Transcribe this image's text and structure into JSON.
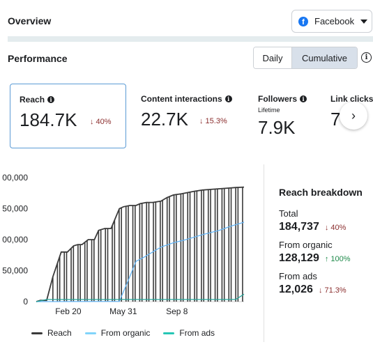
{
  "header": {
    "title": "Overview",
    "platform": {
      "label": "Facebook",
      "icon": "facebook-icon"
    }
  },
  "performance": {
    "title": "Performance",
    "toggles": [
      {
        "label": "Daily",
        "active": false
      },
      {
        "label": "Cumulative",
        "active": true
      }
    ]
  },
  "metrics": [
    {
      "label": "Reach",
      "value": "184.7K",
      "change": "↓ 40%",
      "selected": true
    },
    {
      "label": "Content interactions",
      "value": "22.7K",
      "change": "↓ 15.3%",
      "selected": false
    },
    {
      "label": "Followers",
      "sub": "Lifetime",
      "value": "7.9K",
      "selected": false
    },
    {
      "label": "Link clicks",
      "value": "7",
      "selected": false
    }
  ],
  "breakdown": {
    "title": "Reach breakdown",
    "rows": [
      {
        "label": "Total",
        "value": "184,737",
        "change": "↓ 40%",
        "direction": "down"
      },
      {
        "label": "From organic",
        "value": "128,129",
        "change": "↑ 100%",
        "direction": "up"
      },
      {
        "label": "From ads",
        "value": "12,026",
        "change": "↓ 71.3%",
        "direction": "down"
      }
    ]
  },
  "colors": {
    "reach": "#3a3a3a",
    "organic": "#64b5f6",
    "ads": "#26a69a",
    "down": "#8b2e2e",
    "up": "#1e8a4a"
  },
  "chart_data": {
    "type": "line",
    "y_tick_labels": [
      "0",
      "50,000",
      "00,000",
      "50,000",
      "00,000"
    ],
    "y_tick_values": [
      0,
      50000,
      100000,
      150000,
      200000
    ],
    "ylim": [
      0,
      200000
    ],
    "x_tick_labels": [
      "Feb 20",
      "May 31",
      "Sep 8"
    ],
    "x_tick_positions": [
      0.154,
      0.419,
      0.677
    ],
    "series": [
      {
        "name": "Reach",
        "color": "#3a3a3a",
        "x": [
          0.0,
          0.02,
          0.05,
          0.08,
          0.12,
          0.15,
          0.18,
          0.2,
          0.22,
          0.25,
          0.28,
          0.3,
          0.33,
          0.36,
          0.4,
          0.42,
          0.45,
          0.48,
          0.5,
          0.53,
          0.56,
          0.6,
          0.63,
          0.66,
          0.7,
          0.73,
          0.76,
          0.8,
          0.84,
          0.88,
          0.92,
          0.96,
          1.0
        ],
        "y": [
          0,
          2000,
          2000,
          40000,
          80000,
          80000,
          90000,
          92000,
          92000,
          100000,
          100000,
          115000,
          118000,
          118000,
          150000,
          153000,
          155000,
          155000,
          158000,
          160000,
          160000,
          162000,
          168000,
          172000,
          174000,
          176000,
          178000,
          180000,
          181000,
          182000,
          183000,
          184000,
          184737
        ]
      },
      {
        "name": "From organic",
        "color": "#64b5f6",
        "x": [
          0.0,
          0.4,
          0.45,
          0.48,
          0.52,
          0.56,
          0.6,
          0.66,
          0.72,
          0.8,
          0.88,
          0.94,
          1.0
        ],
        "y": [
          0,
          500,
          40000,
          65000,
          72000,
          80000,
          88000,
          95000,
          100000,
          108000,
          115000,
          122000,
          128129
        ]
      },
      {
        "name": "From ads",
        "color": "#26a69a",
        "x": [
          0.0,
          0.05,
          0.1,
          0.3,
          0.5,
          0.7,
          0.9,
          0.96,
          1.0
        ],
        "y": [
          0,
          3500,
          3500,
          3500,
          3500,
          3500,
          3500,
          3500,
          12026
        ]
      }
    ]
  }
}
